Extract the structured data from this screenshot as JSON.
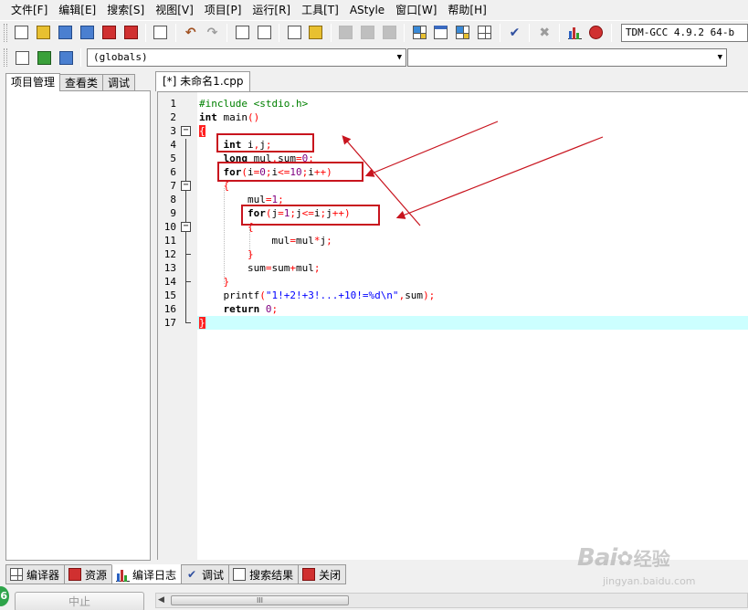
{
  "menu": [
    "文件[F]",
    "编辑[E]",
    "搜索[S]",
    "视图[V]",
    "项目[P]",
    "运行[R]",
    "工具[T]",
    "AStyle",
    "窗口[W]",
    "帮助[H]"
  ],
  "toolbar": {
    "compiler": "TDM-GCC 4.9.2 64-b"
  },
  "combos": {
    "scope": "(globals)",
    "members": ""
  },
  "left_tabs": [
    "项目管理",
    "查看类",
    "调试"
  ],
  "editor": {
    "tab_label": "[*] 未命名1.cpp",
    "line_numbers": [
      "1",
      "2",
      "3",
      "4",
      "5",
      "6",
      "7",
      "8",
      "9",
      "10",
      "11",
      "12",
      "13",
      "14",
      "15",
      "16",
      "17"
    ]
  },
  "bottom_tabs": [
    "编译器",
    "资源",
    "编译日志",
    "调试",
    "搜索结果",
    "关闭"
  ],
  "status": {
    "stop_label": "中止",
    "badge": "6",
    "scroll_thumb": "III"
  },
  "watermark": {
    "brand": "Bai",
    "brand2": "经验",
    "url": "jingyan.baidu.com"
  },
  "colors": {
    "annotation": "#c8141e",
    "current_line": "#ccffff",
    "brace": "#ff2020"
  }
}
